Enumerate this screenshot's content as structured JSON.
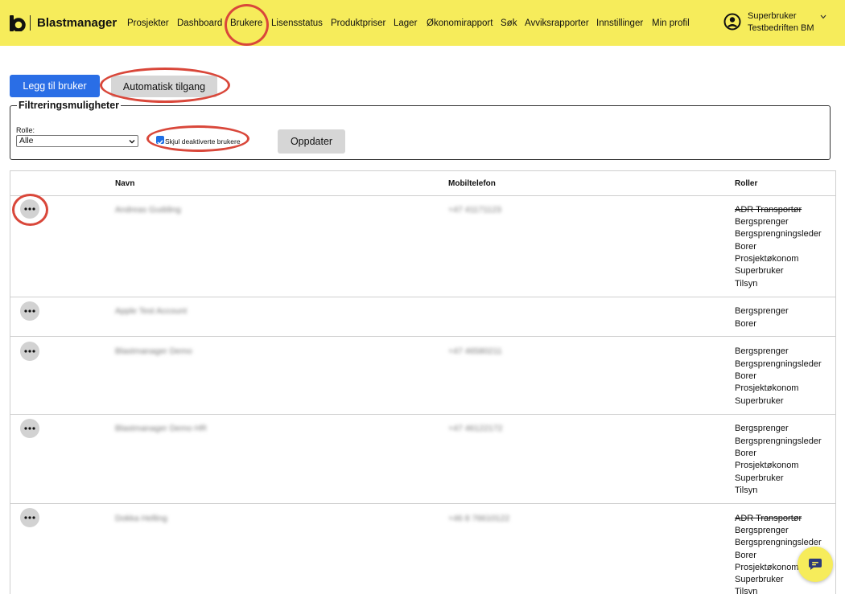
{
  "header": {
    "brand": "Blastmanager",
    "nav": [
      "Prosjekter",
      "Dashboard",
      "Brukere",
      "Lisensstatus",
      "Produktpriser",
      "Lager",
      "Økonomirapport",
      "Søk",
      "Avviksrapporter",
      "Innstillinger",
      "Min profil"
    ],
    "active_nav": "Brukere",
    "user": {
      "name": "Superbruker",
      "company": "Testbedriften BM"
    },
    "accent_color": "#f6ec5b"
  },
  "actions": {
    "add_user_label": "Legg til bruker",
    "auto_access_label": "Automatisk tilgang"
  },
  "filter": {
    "legend": "Filtreringsmuligheter",
    "role_label": "Rolle:",
    "role_selected": "Alle",
    "hide_deactivated_label": "Skjul deaktiverte brukere",
    "hide_deactivated_checked": true,
    "update_label": "Oppdater"
  },
  "table": {
    "columns": [
      "Navn",
      "Mobiltelefon",
      "Roller"
    ],
    "rows": [
      {
        "name": "Andreas Gudding",
        "phone": "+47 41171123",
        "roles": [
          {
            "label": "ADR Transportør",
            "struck": true
          },
          {
            "label": "Bergsprenger",
            "struck": false
          },
          {
            "label": "Bergsprengningsleder",
            "struck": false
          },
          {
            "label": "Borer",
            "struck": false
          },
          {
            "label": "Prosjektøkonom",
            "struck": false
          },
          {
            "label": "Superbruker",
            "struck": false
          },
          {
            "label": "Tilsyn",
            "struck": false
          }
        ]
      },
      {
        "name": "Apple Test Account",
        "phone": "",
        "roles": [
          {
            "label": "Bergsprenger",
            "struck": false
          },
          {
            "label": "Borer",
            "struck": false
          }
        ]
      },
      {
        "name": "Blastmanager Demo",
        "phone": "+47 46580211",
        "roles": [
          {
            "label": "Bergsprenger",
            "struck": false
          },
          {
            "label": "Bergsprengningsleder",
            "struck": false
          },
          {
            "label": "Borer",
            "struck": false
          },
          {
            "label": "Prosjektøkonom",
            "struck": false
          },
          {
            "label": "Superbruker",
            "struck": false
          }
        ]
      },
      {
        "name": "Blastmanager Demo HR",
        "phone": "+47 46122172",
        "roles": [
          {
            "label": "Bergsprenger",
            "struck": false
          },
          {
            "label": "Bergsprengningsleder",
            "struck": false
          },
          {
            "label": "Borer",
            "struck": false
          },
          {
            "label": "Prosjektøkonom",
            "struck": false
          },
          {
            "label": "Superbruker",
            "struck": false
          },
          {
            "label": "Tilsyn",
            "struck": false
          }
        ]
      },
      {
        "name": "Dokka Helling",
        "phone": "+46 8 76610122",
        "roles": [
          {
            "label": "ADR Transportør",
            "struck": true
          },
          {
            "label": "Bergsprenger",
            "struck": false
          },
          {
            "label": "Bergsprengningsleder",
            "struck": false
          },
          {
            "label": "Borer",
            "struck": false
          },
          {
            "label": "Prosjektøkonom",
            "struck": false
          },
          {
            "label": "Superbruker",
            "struck": false
          },
          {
            "label": "Tilsyn",
            "struck": false
          }
        ]
      }
    ]
  },
  "icons": {
    "logo": "blastmanager-logo-icon",
    "user": "user-circle-icon",
    "chevron": "chevron-down-icon",
    "row_menu": "more-dots-icon",
    "chat": "chat-icon"
  },
  "colors": {
    "primary": "#2a6ee6",
    "annotation": "#d9473a",
    "secondary_button": "#d6d6d6"
  }
}
